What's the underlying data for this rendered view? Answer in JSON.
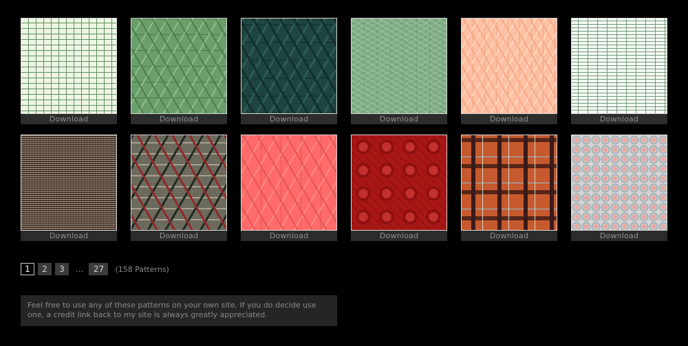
{
  "patterns_row1": [
    {
      "download_label": "Download"
    },
    {
      "download_label": "Download"
    },
    {
      "download_label": "Download"
    },
    {
      "download_label": "Download"
    },
    {
      "download_label": "Download"
    },
    {
      "download_label": "Download"
    }
  ],
  "patterns_row2": [
    {
      "download_label": "Download"
    },
    {
      "download_label": "Download"
    },
    {
      "download_label": "Download"
    },
    {
      "download_label": "Download"
    },
    {
      "download_label": "Download"
    },
    {
      "download_label": "Download"
    }
  ],
  "pagination": {
    "pages": [
      "1",
      "2",
      "3"
    ],
    "ellipsis": "...",
    "last_page": "27",
    "count_text": "(158 Patterns)"
  },
  "note_text": "Feel free to use any of these patterns on your own site. If you do decide use one, a credit link back to my site is always greatly appreciated.",
  "colors": {
    "background": "#000000",
    "download_bar": "#2c2c2c",
    "download_text": "#8f8f8f",
    "page_button": "#3c3c3c",
    "note_box": "#252525"
  }
}
